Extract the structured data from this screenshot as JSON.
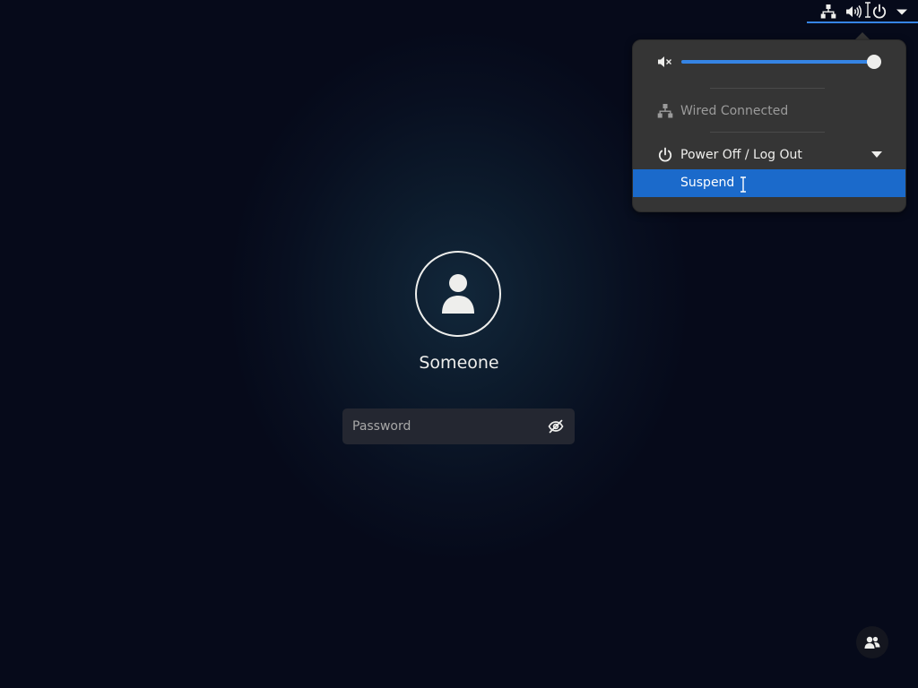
{
  "top_bar": {
    "icons": [
      "network-wired-icon",
      "volume-high-icon",
      "power-icon",
      "menu-arrow-icon"
    ],
    "accent_color": "#3584e4"
  },
  "system_menu": {
    "volume": {
      "icon": "volume-muted-icon",
      "level": 1.0
    },
    "network": {
      "icon": "network-wired-icon",
      "label": "Wired Connected"
    },
    "power": {
      "icon": "power-icon",
      "label": "Power Off / Log Out",
      "expanded": true,
      "submenu": [
        {
          "label": "Suspend",
          "highlighted": true
        }
      ]
    },
    "highlight_color": "#1b6acb"
  },
  "login": {
    "username": "Someone",
    "password": {
      "placeholder": "Password",
      "value": ""
    }
  },
  "bottom_right": {
    "icon": "switch-user-icon"
  }
}
